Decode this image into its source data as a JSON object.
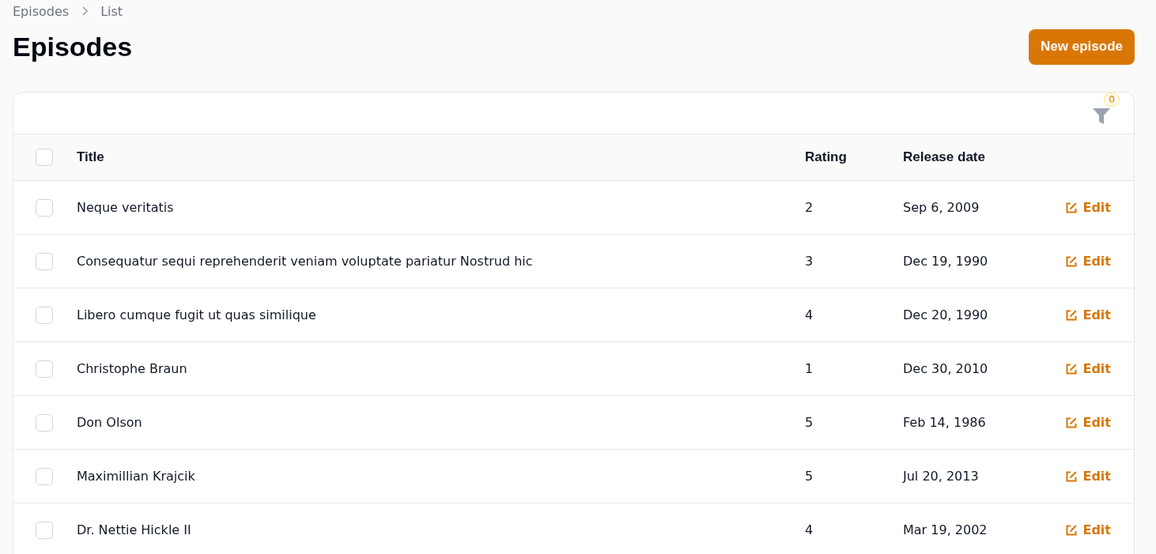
{
  "breadcrumbs": [
    "Episodes",
    "List"
  ],
  "page_title": "Episodes",
  "new_button": "New episode",
  "filter": {
    "count": "0"
  },
  "table": {
    "select_all_checked": false,
    "columns": [
      "Title",
      "Rating",
      "Release date"
    ],
    "rows": [
      {
        "title": "Neque veritatis",
        "rating": "2",
        "release_date": "Sep 6, 2009",
        "action": "Edit",
        "checked": false
      },
      {
        "title": "Consequatur sequi reprehenderit veniam voluptate pariatur Nostrud hic",
        "rating": "3",
        "release_date": "Dec 19, 1990",
        "action": "Edit",
        "checked": false
      },
      {
        "title": "Libero cumque fugit ut quas similique",
        "rating": "4",
        "release_date": "Dec 20, 1990",
        "action": "Edit",
        "checked": false
      },
      {
        "title": "Christophe Braun",
        "rating": "1",
        "release_date": "Dec 30, 2010",
        "action": "Edit",
        "checked": false
      },
      {
        "title": "Don Olson",
        "rating": "5",
        "release_date": "Feb 14, 1986",
        "action": "Edit",
        "checked": false
      },
      {
        "title": "Maximillian Krajcik",
        "rating": "5",
        "release_date": "Jul 20, 2013",
        "action": "Edit",
        "checked": false
      },
      {
        "title": "Dr. Nettie Hickle II",
        "rating": "4",
        "release_date": "Mar 19, 2002",
        "action": "Edit",
        "checked": false
      }
    ]
  }
}
